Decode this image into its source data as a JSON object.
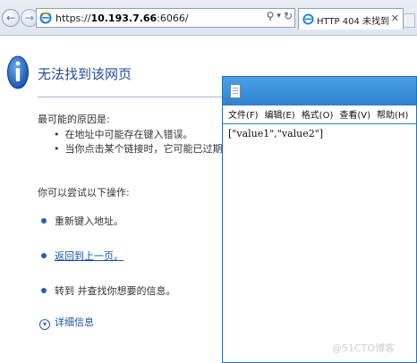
{
  "browser": {
    "url_prefix": "https://",
    "url_host": "10.193.7.66",
    "url_rest": ":6066/",
    "search_glyph": "⚲",
    "dropdown_glyph": "▾",
    "refresh_glyph": "↻",
    "tab_label": "HTTP 404 未找到",
    "tab_close": "✕"
  },
  "error_page": {
    "title": "无法找到该网页",
    "causes_heading": "最可能的原因是:",
    "causes": [
      "在地址中可能存在键入错误。",
      "当你点击某个链接时，它可能已过期。"
    ],
    "try_heading": "你可以尝试以下操作:",
    "actions": [
      {
        "text": "重新键入地址。"
      },
      {
        "link": "返回到上一页。"
      },
      {
        "text": "转到  并查找你想要的信息。"
      }
    ],
    "more_info": "详细信息",
    "more_info_glyph": "▾"
  },
  "notepad": {
    "menu": [
      "文件(F)",
      "编辑(E)",
      "格式(O)",
      "查看(V)",
      "帮助(H)"
    ],
    "content": "[\"value1\",\"value2\"]"
  },
  "watermark": "@51CTO博客",
  "colors": {
    "link": "#1a53a8",
    "title": "#1f4e99",
    "notepad_title": "#3d8ed6"
  }
}
